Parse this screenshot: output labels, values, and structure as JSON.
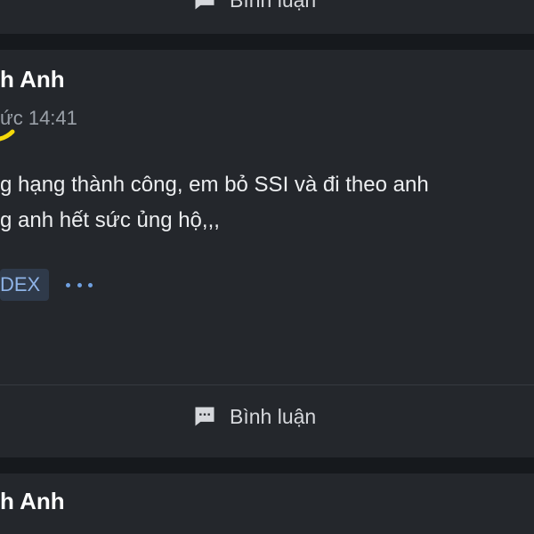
{
  "top_card": {
    "comment_label": "Bình luận",
    "comment_icon": "comment-icon"
  },
  "post": {
    "author": "h Anh",
    "timestamp": "ức 14:41",
    "body_lines": [
      "g hạng thành công, em bỏ SSI và đi theo anh",
      "g anh hết sức ủng hộ,,,"
    ],
    "tag": "DEX",
    "more_icon": "more-horizontal-icon",
    "comment_label": "Bình luận",
    "comment_icon": "comment-icon"
  },
  "next_post": {
    "author": "h Anh"
  },
  "colors": {
    "page_bg": "#16191d",
    "card_bg": "#24272c",
    "tag_bg": "#2f3a4a",
    "tag_text": "#8fb4e8",
    "accent": "#6fa0e0",
    "highlight": "#f5d90a"
  }
}
